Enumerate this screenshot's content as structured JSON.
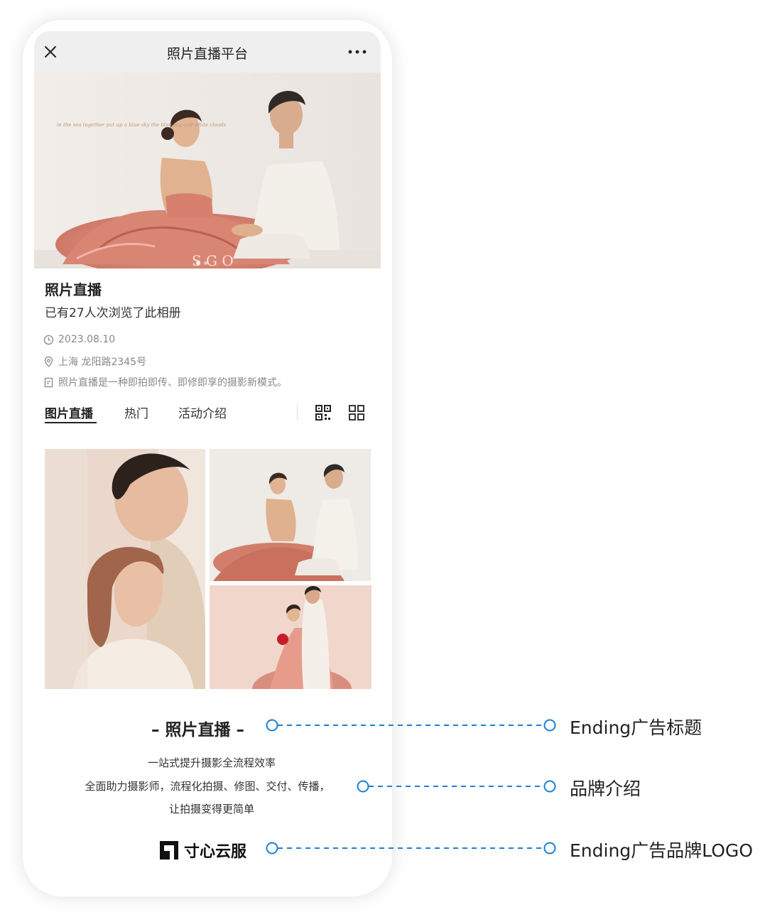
{
  "nav": {
    "title": "照片直播平台",
    "close_icon": "close-icon",
    "more_icon": "more-icon"
  },
  "album": {
    "title": "照片直播",
    "views": "已有27人次浏览了此相册",
    "date": "2023.08.10",
    "location": "上海 龙阳路2345号",
    "description": "照片直播是一种即拍即传、即修即享的摄影新模式。"
  },
  "tabs": [
    {
      "label": "图片直播",
      "active": true
    },
    {
      "label": "热门",
      "active": false
    },
    {
      "label": "活动介绍",
      "active": false
    }
  ],
  "ending": {
    "title": "– 照片直播 –",
    "brand_lines": [
      "一站式提升摄影全流程效率",
      "全面助力摄影师，流程化拍摄、修图、交付、传播，",
      "让拍摄变得更简单"
    ],
    "logo_text": "寸心云服"
  },
  "annotations": {
    "title": "Ending广告标题",
    "brand": "品牌介绍",
    "logo": "Ending广告品牌LOGO"
  },
  "hero_script_text": "in the sea  together put up a blue sky  the blue sky and white clouds",
  "colors": {
    "callout": "#1e7fd6",
    "tab_active": "#222222",
    "meta": "#888888"
  }
}
